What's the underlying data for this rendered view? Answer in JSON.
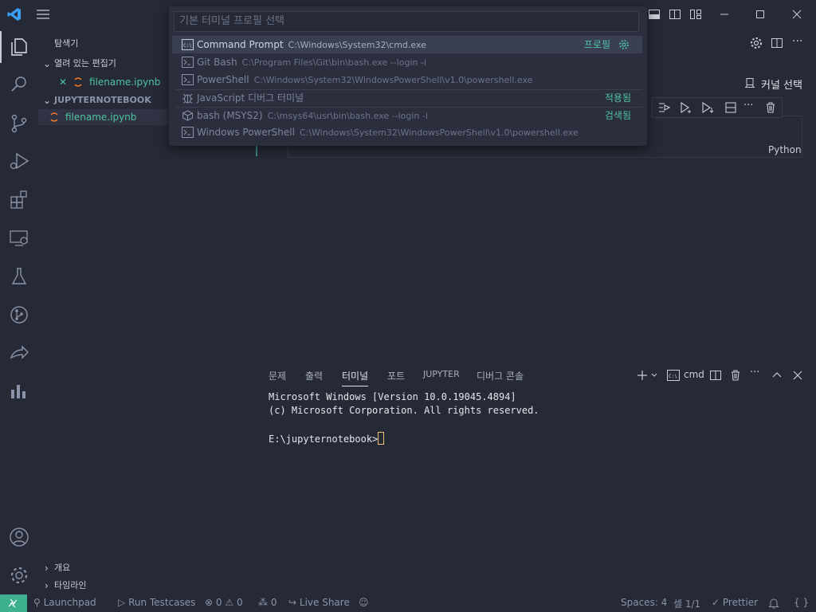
{
  "titlebar": {
    "menu_icon": "hamburger-icon"
  },
  "quickpick": {
    "placeholder": "기본 터미널 프로필 선택",
    "items": [
      {
        "label": "Command Prompt",
        "desc": "C:\\Windows\\System32\\cmd.exe",
        "right": "프로필",
        "icon": "terminal-cmd-icon"
      },
      {
        "label": "Git Bash",
        "desc": "C:\\Program Files\\Git\\bin\\bash.exe --login -i",
        "right": "",
        "icon": "terminal-icon"
      },
      {
        "label": "PowerShell",
        "desc": "C:\\Windows\\System32\\WindowsPowerShell\\v1.0\\powershell.exe",
        "right": "",
        "icon": "terminal-icon"
      },
      {
        "label": "JavaScript 디버그 터미널",
        "desc": "",
        "right": "적용됨",
        "icon": "debug-icon"
      },
      {
        "label": "bash (MSYS2)",
        "desc": "C:\\msys64\\usr\\bin\\bash.exe --login -i",
        "right": "검색됨",
        "icon": "package-icon"
      },
      {
        "label": "Windows PowerShell",
        "desc": "C:\\Windows\\System32\\WindowsPowerShell\\v1.0\\powershell.exe",
        "right": "",
        "icon": "terminal-icon"
      }
    ]
  },
  "sidebar": {
    "title": "탐색기",
    "open_editors_label": "열려 있는 편집기",
    "open_file": "filename.ipynb",
    "folder_label": "JUPYTERNOTEBOOK",
    "folder_file": "filename.ipynb",
    "outline_label": "개요",
    "timeline_label": "타임라인"
  },
  "editor": {
    "kernel_label": "커널 선택",
    "cell_language": "Python"
  },
  "panel": {
    "tabs": [
      "문제",
      "출력",
      "터미널",
      "포트",
      "JUPYTER",
      "디버그 콘솔"
    ],
    "active_tab": "터미널",
    "terminal_name": "cmd",
    "terminal_lines": [
      "Microsoft Windows [Version 10.0.19045.4894]",
      "(c) Microsoft Corporation. All rights reserved.",
      "",
      "E:\\jupyternotebook>"
    ]
  },
  "statusbar": {
    "launchpad": "Launchpad",
    "run_testcases": "Run Testcases",
    "errors": "0",
    "warnings": "0",
    "ports": "0",
    "live_share": "Live Share",
    "spaces": "Spaces: 4",
    "cell": "셀 1/1",
    "prettier": "Prettier"
  },
  "colors": {
    "background": "#262a37",
    "accent": "#4fc3a1",
    "remote": "#3eb08f",
    "text": "#c8ccd6"
  }
}
